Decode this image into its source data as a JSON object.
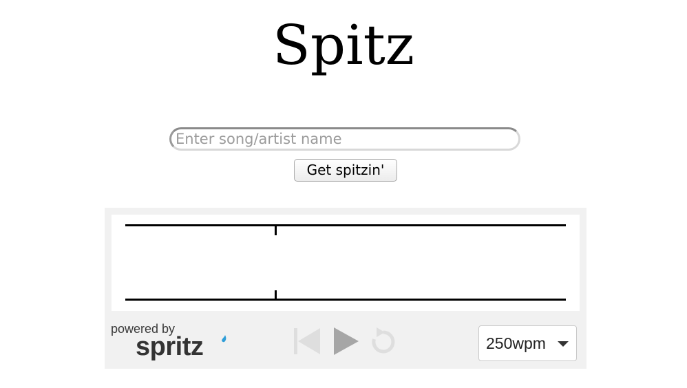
{
  "page": {
    "title": "Spitz"
  },
  "search": {
    "placeholder": "Enter song/artist name",
    "value": ""
  },
  "submit": {
    "label": "Get spitzin'"
  },
  "spritz": {
    "powered_by": "powered by",
    "brand": "spritz",
    "controls": [
      {
        "name": "skip-back",
        "icon": "skip-back-icon",
        "enabled": false
      },
      {
        "name": "play",
        "icon": "play-icon",
        "enabled": true
      },
      {
        "name": "restart",
        "icon": "restart-icon",
        "enabled": false
      }
    ],
    "speed": {
      "selected": "250wpm"
    },
    "colors": {
      "panel_bg": "#f1f1f1",
      "brand_accent": "#2f9ed8"
    }
  }
}
